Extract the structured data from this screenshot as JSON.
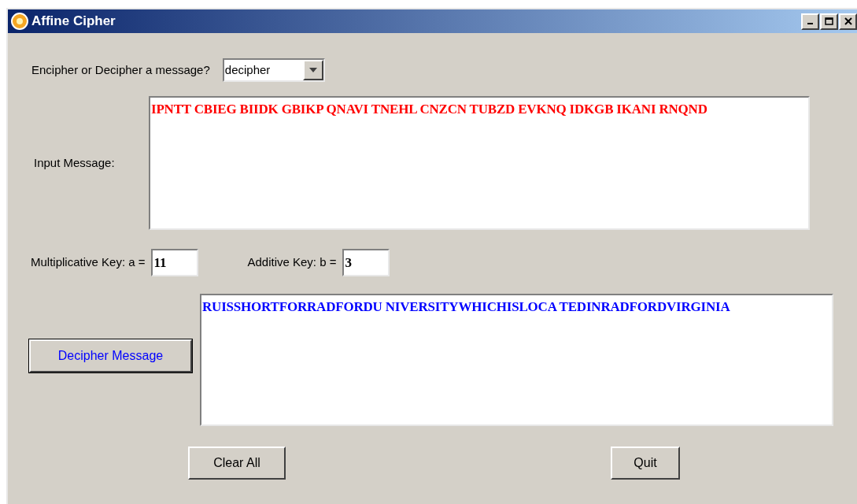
{
  "window": {
    "title": "Affine Cipher"
  },
  "mode": {
    "label": "Encipher or Decipher a message?",
    "value": "decipher"
  },
  "input": {
    "label": "Input Message:",
    "value": "IPNTT CBIEG BIIDK GBIKP QNAVI TNEHL CNZCN TUBZD EVKNQ IDKGB IKANI RNQND"
  },
  "keys": [
    {
      "label": "Multiplicative Key: a =",
      "value": "11"
    },
    {
      "label": "Additive Key: b =",
      "value": "3"
    }
  ],
  "action_button": "Decipher Message",
  "output": {
    "value": "RUISSHORTFORRADFORDU NIVERSITYWHICHISLOCA TEDINRADFORDVIRGINIA"
  },
  "buttons": [
    "Clear All",
    "Quit"
  ]
}
